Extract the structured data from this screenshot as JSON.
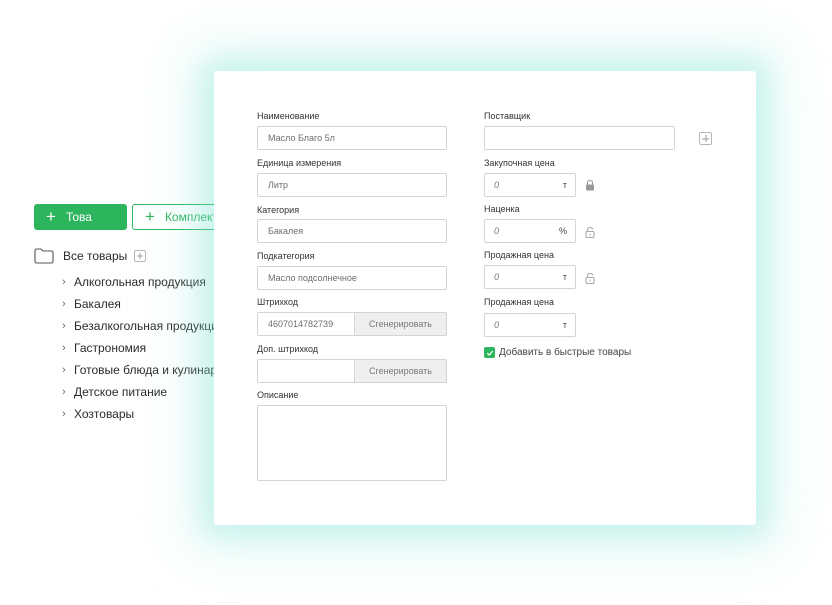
{
  "left_panel": {
    "add_product_button": "Това",
    "add_kit_button": "Комплект",
    "tree_root_label": "Все товары",
    "categories": [
      {
        "label": "Алкогольная продукция"
      },
      {
        "label": "Бакалея"
      },
      {
        "label": "Безалкогольная продукция"
      },
      {
        "label": "Гастрономия"
      },
      {
        "label": "Готовые блюда и кулинария"
      },
      {
        "label": "Детское питание"
      },
      {
        "label": "Хозтовары"
      }
    ]
  },
  "form": {
    "name": {
      "label": "Наименование",
      "value": "Масло Благо 5л"
    },
    "unit": {
      "label": "Единица измерения",
      "value": "Литр"
    },
    "category": {
      "label": "Категория",
      "value": "Бакалея"
    },
    "subcategory": {
      "label": "Подкатегория",
      "value": "Масло подсолнечное"
    },
    "barcode": {
      "label": "Штрихкод",
      "value": "4607014782739",
      "button": "Сгенерировать"
    },
    "extra_barcode": {
      "label": "Доп. штрихкод",
      "value": "",
      "button": "Сгенерировать"
    },
    "description": {
      "label": "Описание",
      "value": ""
    },
    "supplier": {
      "label": "Поставщик",
      "value": ""
    },
    "purchase_price": {
      "label": "Закупочная цена",
      "value": "0",
      "unit": "т"
    },
    "markup": {
      "label": "Наценка",
      "value": "0",
      "unit": "%"
    },
    "sale_price": {
      "label": "Продажная цена",
      "value": "0",
      "unit": "т"
    },
    "sale_price_2": {
      "label": "Продажная цена",
      "value": "0",
      "unit": "т"
    },
    "quick_products": {
      "label": "Добавить в быстрые товары",
      "checked": true
    }
  },
  "colors": {
    "accent": "#2db55d",
    "glow": "#7ee1d2"
  }
}
